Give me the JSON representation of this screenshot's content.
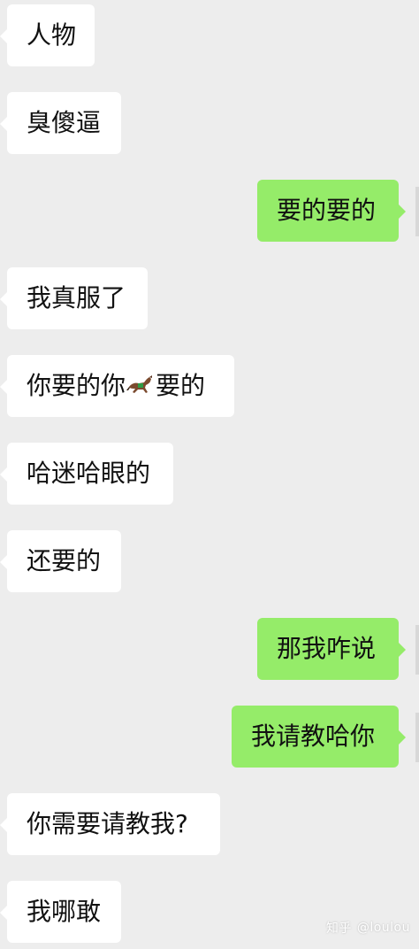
{
  "messages": [
    {
      "side": "left",
      "text": "人物"
    },
    {
      "side": "left",
      "text": "臭傻逼"
    },
    {
      "side": "right",
      "text": "要的要的"
    },
    {
      "side": "left",
      "text": "我真服了"
    },
    {
      "side": "left",
      "text_before": "你要的你",
      "emoji_icon": "horse-icon",
      "text_after": "要的"
    },
    {
      "side": "left",
      "text": "哈迷哈眼的"
    },
    {
      "side": "left",
      "text": "还要的"
    },
    {
      "side": "right",
      "text": "那我咋说"
    },
    {
      "side": "right",
      "text": "我请教哈你"
    },
    {
      "side": "left",
      "text": "你需要请教我?"
    },
    {
      "side": "left",
      "text": "我哪敢"
    }
  ],
  "watermark": {
    "brand": "知乎",
    "handle": "@loulou"
  },
  "colors": {
    "background": "#ededed",
    "incoming_bubble": "#ffffff",
    "outgoing_bubble": "#95ec69",
    "text": "#111111"
  }
}
